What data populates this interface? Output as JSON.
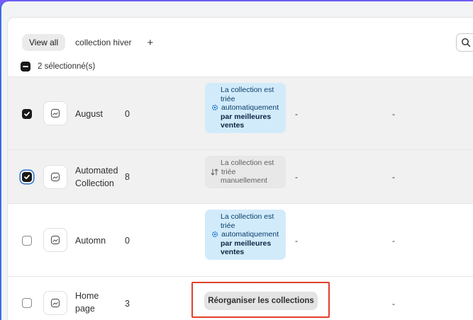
{
  "tabs": [
    {
      "label": "View all",
      "active": true
    },
    {
      "label": "collection hiver",
      "active": false
    }
  ],
  "add_tab_label": "+",
  "search_icon": "search-icon",
  "selection": {
    "label": "2 sélectionné(s)"
  },
  "rows": [
    {
      "name_lines": [
        "August"
      ],
      "count": "0",
      "checked": true,
      "badge": {
        "type": "info",
        "lines": [
          "La collection est",
          "triée",
          "automatiquement"
        ],
        "bold": [
          "par meilleures",
          "ventes"
        ],
        "icon": "gear-sparkle-icon"
      },
      "col4": "-",
      "col5": "-"
    },
    {
      "name_lines": [
        "Automated",
        "Collection"
      ],
      "count": "8",
      "checked": true,
      "badge": {
        "type": "neutral",
        "lines": [
          "La collection est",
          "triée",
          "manuellement"
        ],
        "bold": [],
        "icon": "manual-sort-icon"
      },
      "col4": "-",
      "col5": "-"
    },
    {
      "name_lines": [
        "Automn"
      ],
      "count": "0",
      "checked": false,
      "badge": {
        "type": "info",
        "lines": [
          "La collection est",
          "triée",
          "automatiquement"
        ],
        "bold": [
          "par meilleures",
          "ventes"
        ],
        "icon": "gear-sparkle-icon"
      },
      "col4": "-",
      "col5": "-"
    },
    {
      "name_lines": [
        "Home",
        "page"
      ],
      "count": "3",
      "checked": false,
      "badge": null,
      "col4": "",
      "col5": "-"
    }
  ],
  "reorder_button": {
    "label": "Réorganiser les collections"
  },
  "colors": {
    "accent": "#2c6ecb",
    "highlight_border": "#e0402c",
    "badge_info_bg": "#d2ebfb"
  }
}
